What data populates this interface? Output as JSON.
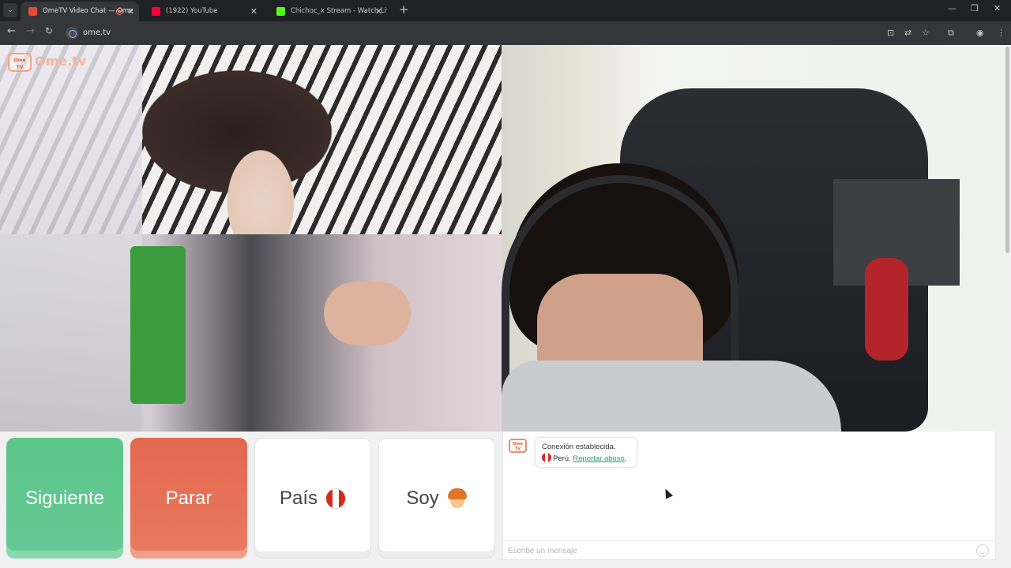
{
  "browser": {
    "tabs": [
      {
        "title": "OmeTV Video Chat — Ome",
        "favicon_color": "#e34a3d",
        "active": true
      },
      {
        "title": "(1922) YouTube",
        "favicon_color": "#ff0033",
        "active": false
      },
      {
        "title": "Chichoc_x Stream - Watch Live",
        "favicon_color": "#53fc18",
        "active": false
      }
    ],
    "url": "ome.tv"
  },
  "page": {
    "logo_badge": "Ome TV",
    "logo_text": "Ome.tv",
    "controls": {
      "next_label": "Siguiente",
      "stop_label": "Parar",
      "country_label": "País",
      "gender_label": "Soy"
    },
    "chat": {
      "avatar_text": "Ome TV",
      "system_message": "Conexión establecida.",
      "country_name": "Perú.",
      "report_link": "Reportar abuso",
      "report_suffix": ".",
      "input_placeholder": "Escribe un mensaje"
    }
  },
  "colors": {
    "next": "#5cc58a",
    "stop": "#e3684e",
    "link": "#2e9a72"
  }
}
